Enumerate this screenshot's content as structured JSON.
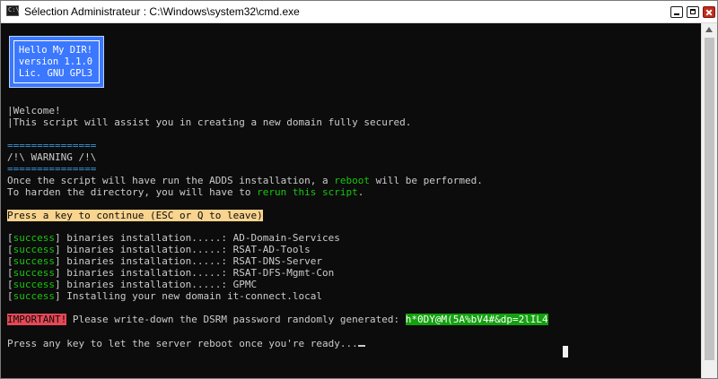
{
  "window": {
    "icon_text": "C:\\",
    "title": "Sélection Administrateur : C:\\Windows\\system32\\cmd.exe"
  },
  "banner": {
    "line1": "Hello My DIR!",
    "line2": "version 1.1.0",
    "line3": "Lic. GNU GPL3"
  },
  "intro": {
    "welcome": "|Welcome!",
    "description": "|This script will assist you in creating a new domain fully secured."
  },
  "warning": {
    "rule_top": "===============",
    "title": "/!\\ WARNING /!\\",
    "rule_bottom": "===============",
    "line1_a": "Once the script will have run the ADDS installation, a ",
    "line1_b": "reboot",
    "line1_c": " will be performed.",
    "line2_a": "To harden the directory, you will have to ",
    "line2_b": "rerun this script",
    "line2_c": "."
  },
  "prompt_continue": "Press a key to continue (ESC or Q to leave)",
  "results": [
    {
      "status": "success",
      "open": "[",
      "close": "]",
      "message": " binaries installation.....: AD-Domain-Services"
    },
    {
      "status": "success",
      "open": "[",
      "close": "]",
      "message": " binaries installation.....: RSAT-AD-Tools"
    },
    {
      "status": "success",
      "open": "[",
      "close": "]",
      "message": " binaries installation.....: RSAT-DNS-Server"
    },
    {
      "status": "success",
      "open": "[",
      "close": "]",
      "message": " binaries installation.....: RSAT-DFS-Mgmt-Con"
    },
    {
      "status": "success",
      "open": "[",
      "close": "]",
      "message": " binaries installation.....: GPMC"
    },
    {
      "status": "success",
      "open": "[",
      "close": "]",
      "message": " Installing your new domain it-connect.local"
    }
  ],
  "important": {
    "tag": "IMPORTANT!",
    "message": " Please write-down the DSRM password randomly generated: ",
    "password": "h*0DY@M(5A%bV4#&dp=2lIL4"
  },
  "final_prompt": "Press any key to let the server reboot once you're ready...",
  "colors": {
    "console_bg": "#0c0c0c",
    "text": "#cccccc",
    "green": "#16c60c",
    "cyan": "#3a96dd",
    "banner_bg": "#3b78ff",
    "press_bg": "#f9d48e",
    "important_bg": "#e74856",
    "password_bg": "#13a10e"
  }
}
